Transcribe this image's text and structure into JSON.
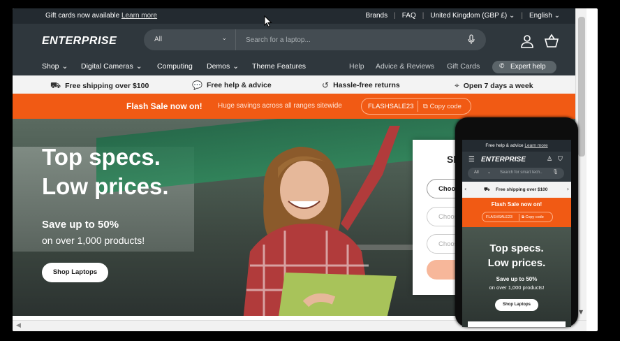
{
  "announcement": {
    "text": "Gift cards now available",
    "link": "Learn more",
    "brands": "Brands",
    "faq": "FAQ",
    "country": "United Kingdom (GBP £)",
    "language": "English",
    "separator": "|"
  },
  "header": {
    "logo": "ENTERPRISE",
    "search_category": "All",
    "search_placeholder": "Search for a laptop...",
    "icons": [
      "account-icon",
      "cart-icon",
      "microphone-icon"
    ]
  },
  "nav": {
    "items": [
      "Shop",
      "Digital Cameras",
      "Computing",
      "Demos",
      "Theme Features"
    ],
    "secondary": [
      "Help",
      "Advice & Reviews",
      "Gift Cards"
    ],
    "expert": "Expert help"
  },
  "usp": [
    {
      "icon": "truck-icon",
      "text": "Free shipping over $100"
    },
    {
      "icon": "chat-icon",
      "text": "Free help & advice"
    },
    {
      "icon": "return-icon",
      "text": "Hassle-free returns"
    },
    {
      "icon": "location-icon",
      "text": "Open 7 days a week"
    }
  ],
  "flash": {
    "title": "Flash Sale now on!",
    "subtitle": "Huge savings across all ranges sitewide",
    "code": "FLASHSALE23",
    "copy": "Copy code"
  },
  "hero": {
    "title_line1": "Top specs.",
    "title_line2": "Low prices.",
    "save": "Save up to 50%",
    "sub": "on over 1,000 products!",
    "button": "Shop Laptops"
  },
  "finder": {
    "title": "Shop",
    "select1": "Choose a",
    "select2": "Choose a",
    "select3": "Choose a"
  },
  "mobile": {
    "announcement": "Free help & advice",
    "link": "Learn more",
    "logo": "ENTERPRISE",
    "search_category": "All",
    "search_placeholder": "Search for smart tech..",
    "usp": "Free shipping over $100",
    "flash_title": "Flash Sale now on!",
    "code": "FLASHSALE23",
    "copy": "Copy code",
    "title_line1": "Top specs.",
    "title_line2": "Low prices.",
    "save": "Save up to 50%",
    "sub": "on over 1,000 products!",
    "button": "Shop Laptops"
  },
  "colors": {
    "dark_header": "#2f373d",
    "announcement_bg": "#232a30",
    "accent_orange": "#f15a14"
  }
}
